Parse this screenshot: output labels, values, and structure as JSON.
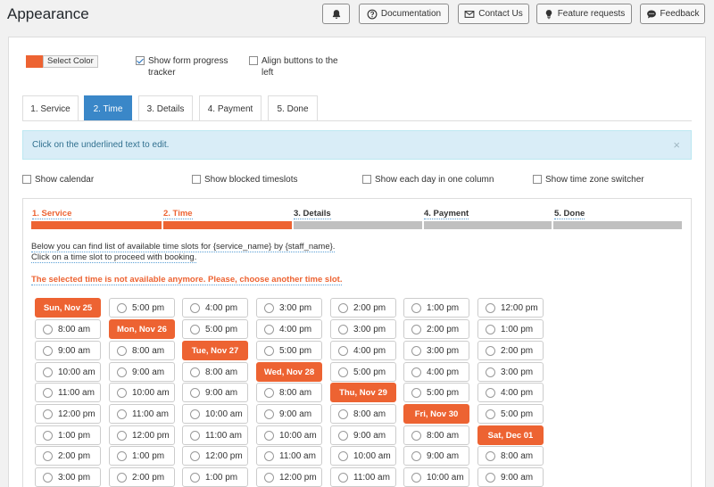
{
  "header": {
    "title": "Appearance",
    "buttons": {
      "bell": "",
      "documentation": "Documentation",
      "contact": "Contact Us",
      "feature": "Feature requests",
      "feedback": "Feedback"
    }
  },
  "options": {
    "select_color": "Select Color",
    "accent_color": "#ed6332",
    "show_progress_line1": "Show form progress",
    "show_progress_line2": "tracker",
    "align_buttons_line1": "Align buttons to the",
    "align_buttons_line2": "left"
  },
  "tabs": [
    "1. Service",
    "2. Time",
    "3. Details",
    "4. Payment",
    "5. Done"
  ],
  "active_tab": "2. Time",
  "alert": {
    "text": "Click on the underlined text to edit.",
    "close": "×"
  },
  "settings": {
    "show_calendar": "Show calendar",
    "show_blocked": "Show blocked timeslots",
    "show_each_day": "Show each day in one column",
    "show_timezone": "Show time zone switcher"
  },
  "progress_steps": [
    "1. Service",
    "2. Time",
    "3. Details",
    "4. Payment",
    "5. Done"
  ],
  "info": {
    "line1": "Below you can find list of available time slots for {service_name} by {staff_name}.",
    "line2": "Click on a time slot to proceed with booking.",
    "error": "The selected time is not available anymore. Please, choose another time slot."
  },
  "slots": [
    [
      "Sun, Nov 25",
      "8:00 am",
      "9:00 am",
      "10:00 am",
      "11:00 am",
      "12:00 pm",
      "1:00 pm",
      "2:00 pm",
      "3:00 pm"
    ],
    [
      "5:00 pm",
      "Mon, Nov 26",
      "8:00 am",
      "9:00 am",
      "10:00 am",
      "11:00 am",
      "12:00 pm",
      "1:00 pm",
      "2:00 pm"
    ],
    [
      "4:00 pm",
      "5:00 pm",
      "Tue, Nov 27",
      "8:00 am",
      "9:00 am",
      "10:00 am",
      "11:00 am",
      "12:00 pm",
      "1:00 pm"
    ],
    [
      "3:00 pm",
      "4:00 pm",
      "5:00 pm",
      "Wed, Nov 28",
      "8:00 am",
      "9:00 am",
      "10:00 am",
      "11:00 am",
      "12:00 pm"
    ],
    [
      "2:00 pm",
      "3:00 pm",
      "4:00 pm",
      "5:00 pm",
      "Thu, Nov 29",
      "8:00 am",
      "9:00 am",
      "10:00 am",
      "11:00 am"
    ],
    [
      "1:00 pm",
      "2:00 pm",
      "3:00 pm",
      "4:00 pm",
      "5:00 pm",
      "Fri, Nov 30",
      "8:00 am",
      "9:00 am",
      "10:00 am"
    ],
    [
      "12:00 pm",
      "1:00 pm",
      "2:00 pm",
      "3:00 pm",
      "4:00 pm",
      "5:00 pm",
      "Sat, Dec 01",
      "8:00 am",
      "9:00 am"
    ]
  ]
}
